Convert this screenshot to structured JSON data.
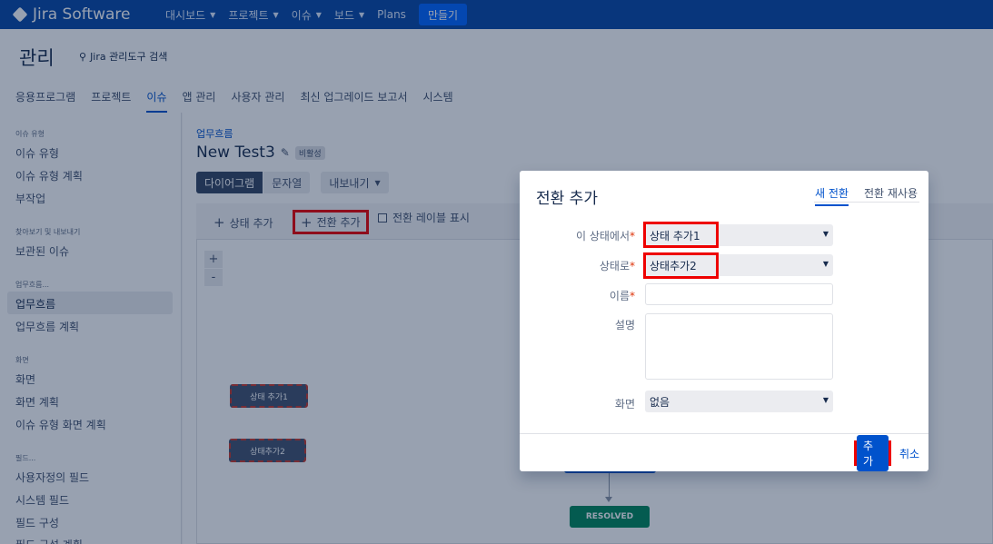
{
  "topbar": {
    "logo": "Jira Software",
    "nav": [
      {
        "label": "대시보드"
      },
      {
        "label": "프로젝트"
      },
      {
        "label": "이슈"
      },
      {
        "label": "보드"
      },
      {
        "label": "Plans"
      }
    ],
    "create": "만들기"
  },
  "header": {
    "title": "관리",
    "search": "Jira 관리도구 검색",
    "tabs": [
      "응용프로그램",
      "프로젝트",
      "이슈",
      "앱 관리",
      "사용자 관리",
      "최신 업그레이드 보고서",
      "시스템"
    ],
    "active_tab": "이슈"
  },
  "sidebar": {
    "sections": [
      {
        "title": "이슈 유형",
        "items": [
          "이슈 유형",
          "이슈 유형 계획",
          "부작업"
        ]
      },
      {
        "title": "찾아보기 및 내보내기",
        "items": [
          "보관된 이슈"
        ]
      },
      {
        "title": "업무흐름...",
        "items": [
          "업무흐름",
          "업무흐름 계획"
        ]
      },
      {
        "title": "화면",
        "items": [
          "화면",
          "화면 계획",
          "이슈 유형 화면 계획"
        ]
      },
      {
        "title": "필드...",
        "items": [
          "사용자정의 필드",
          "시스템 필드",
          "필드 구성",
          "필드 구성 계획"
        ]
      }
    ],
    "active_item": "업무흐름"
  },
  "workflow": {
    "breadcrumb": "업무흐름",
    "name": "New Test3",
    "badge": "비활성",
    "views": [
      "다이어그램",
      "문자열"
    ],
    "export": "내보내기",
    "toolbar": {
      "add_status": "상태 추가",
      "add_transition": "전환 추가",
      "show_labels": "전환 레이블 표시"
    },
    "zoom_in": "+",
    "zoom_out": "-",
    "nodes": [
      "상태 추가1",
      "상태추가2",
      "RESOLVED"
    ]
  },
  "dialog": {
    "title": "전환 추가",
    "tabs": [
      "새 전환",
      "전환 재사용"
    ],
    "fields": {
      "from_label": "이 상태에서",
      "from_value": "상태 추가1",
      "to_label": "상태로",
      "to_value": "상태추가2",
      "name_label": "이름",
      "name_value": "",
      "desc_label": "설명",
      "desc_value": "",
      "screen_label": "화면",
      "screen_value": "없음"
    },
    "submit": "추가",
    "cancel": "취소"
  }
}
